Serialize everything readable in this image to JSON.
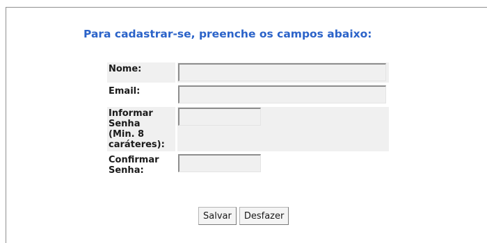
{
  "form": {
    "heading": "Para cadastrar-se, preenche os campos abaixo:",
    "fields": [
      {
        "label": "Nome:",
        "value": "",
        "placeholder": ""
      },
      {
        "label": "Email:",
        "value": "",
        "placeholder": ""
      },
      {
        "label_lines": [
          "Informar",
          "Senha",
          "(Min. 8",
          "caráteres):"
        ],
        "value": "",
        "placeholder": ""
      },
      {
        "label_lines": [
          "Confirmar",
          "Senha:"
        ],
        "value": "",
        "placeholder": ""
      }
    ],
    "buttons": {
      "save_label": "Salvar",
      "reset_label": "Desfazer"
    }
  },
  "colors": {
    "heading": "#2b63c9",
    "field_background": "#f0f0f0"
  }
}
